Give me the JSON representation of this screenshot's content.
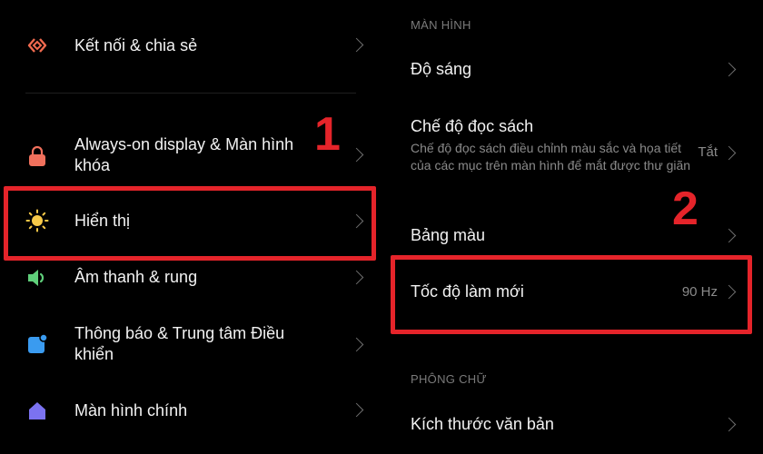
{
  "left": {
    "items": [
      {
        "label": "Kết nối & chia sẻ",
        "icon": "connection-icon"
      },
      {
        "label": "Always-on display & Màn hình khóa",
        "icon": "lock-icon"
      },
      {
        "label": "Hiển thị",
        "icon": "sun-icon"
      },
      {
        "label": "Âm thanh & rung",
        "icon": "speaker-icon"
      },
      {
        "label": "Thông báo & Trung tâm Điều khiển",
        "icon": "notification-icon"
      },
      {
        "label": "Màn hình chính",
        "icon": "home-icon"
      }
    ]
  },
  "right": {
    "section_display": "MÀN HÌNH",
    "brightness": "Độ sáng",
    "reading_mode": {
      "label": "Chế độ đọc sách",
      "description": "Chế độ đọc sách điều chỉnh màu sắc và họa tiết của các mục trên màn hình để mắt được thư giãn",
      "value": "Tắt"
    },
    "color_palette": "Bảng màu",
    "refresh_rate": {
      "label": "Tốc độ làm mới",
      "value": "90 Hz"
    },
    "section_font": "PHÔNG CHỮ",
    "text_size": "Kích thước văn bản"
  },
  "annotations": {
    "step1": "1",
    "step2": "2"
  },
  "colors": {
    "highlight": "#e5242a",
    "background": "#000000"
  }
}
